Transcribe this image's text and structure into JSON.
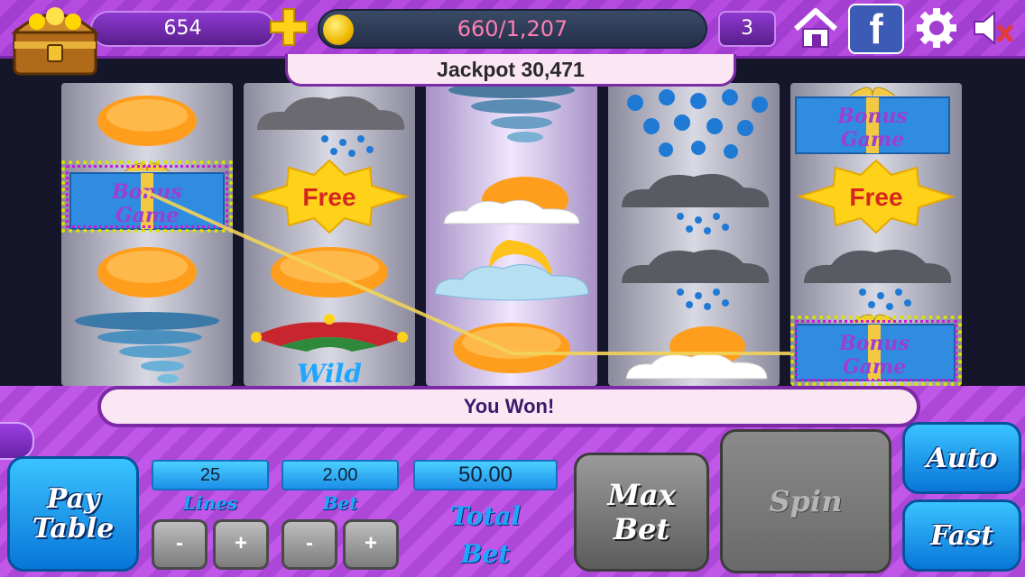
{
  "header": {
    "coins": "654",
    "xp": "660/1,207",
    "level": "3",
    "jackpot": "Jackpot 30,471"
  },
  "icons": [
    "treasure-chest-icon",
    "plus-icon",
    "gold-coin-icon",
    "home-icon",
    "facebook-icon",
    "settings-gear-icon",
    "sound-muted-icon"
  ],
  "facebook_letter": "f",
  "reels": [
    [
      "sun",
      "bonus-game",
      "sun",
      "tornado"
    ],
    [
      "rain-cloud",
      "free",
      "sun",
      "jester-wild"
    ],
    [
      "tornado",
      "sun-behind-cloud",
      "moon-cloud",
      "sun"
    ],
    [
      "raindrops",
      "rain-cloud",
      "rain-cloud",
      "sun-cloud"
    ],
    [
      "bonus-game",
      "free",
      "rain-cloud",
      "bonus-game"
    ]
  ],
  "symbol_text": {
    "bonus_line1": "Bonus",
    "bonus_line2": "Game",
    "free": "Free",
    "wild": "Wild"
  },
  "message": "You Won!",
  "controls": {
    "paytable_line1": "Pay",
    "paytable_line2": "Table",
    "lines_value": "25",
    "lines_label": "Lines",
    "bet_value": "2.00",
    "bet_label": "Bet",
    "total_value": "50.00",
    "total_label_line1": "Total",
    "total_label_line2": "Bet",
    "minus": "-",
    "plus": "+",
    "maxbet_line1": "Max",
    "maxbet_line2": "Bet",
    "spin": "Spin",
    "auto": "Auto",
    "fast": "Fast"
  },
  "colors": {
    "header_purple": "#b54be0",
    "button_blue": "#1c8fe8",
    "win_line": "#f2d35a"
  }
}
